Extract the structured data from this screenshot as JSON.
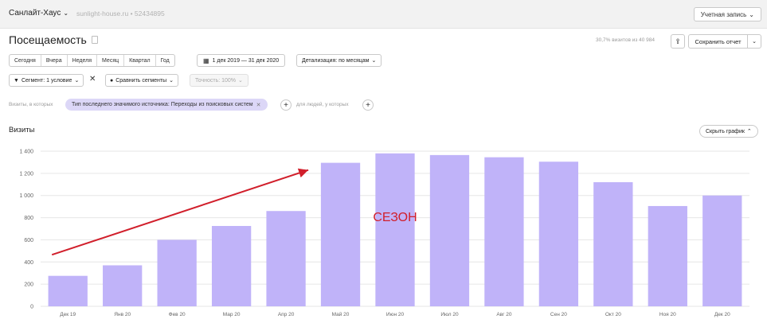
{
  "header": {
    "site_name": "Санлайт-Хаус",
    "site_url": "sunlight-house.ru • 52434895",
    "account_label": "Учетная запись"
  },
  "report": {
    "title": "Посещаемость",
    "visits_info": "30,7% визитов из 40 984",
    "save_label": "Сохранить отчет"
  },
  "periods": [
    "Сегодня",
    "Вчера",
    "Неделя",
    "Месяц",
    "Квартал",
    "Год"
  ],
  "date_range": "1 дек 2019 — 31 дек 2020",
  "detail_label": "Детализация: по месяцам",
  "segment": {
    "label": "Сегмент: 1 условие",
    "compare_label": "Сравнить сегменты",
    "accuracy_label": "Точность: 100%"
  },
  "filter": {
    "prefix": "Визиты, в которых",
    "chip": "Тип последнего значимого источника: Переходы из поисковых систем",
    "people_label": "для людей, у которых"
  },
  "chart_header": {
    "title": "Визиты",
    "hide_label": "Скрыть график"
  },
  "chart_data": {
    "type": "bar",
    "categories": [
      "Дек 19",
      "Янв 20",
      "Фев 20",
      "Мар 20",
      "Апр 20",
      "Май 20",
      "Июн 20",
      "Июл 20",
      "Авг 20",
      "Сен 20",
      "Окт 20",
      "Ноя 20",
      "Дек 20"
    ],
    "values": [
      275,
      370,
      600,
      725,
      860,
      1295,
      1380,
      1365,
      1345,
      1305,
      1120,
      905,
      1000
    ],
    "ylim": [
      0,
      1400
    ],
    "yticks": [
      0,
      200,
      400,
      600,
      800,
      1000,
      1200,
      1400
    ],
    "ytick_labels": [
      "0",
      "200",
      "400",
      "600",
      "800",
      "1 000",
      "1 200",
      "1 400"
    ],
    "grid": true,
    "bar_color": "#c0b3f9",
    "annotation": {
      "text": "СЕЗОН",
      "color": "#d11f2b",
      "arrow": {
        "from": {
          "x": "Дек 19",
          "y": 465
        },
        "to": {
          "x": "Апр 20",
          "y": 1230
        }
      },
      "text_at": {
        "x": "Июн 20",
        "y": 770
      }
    }
  }
}
